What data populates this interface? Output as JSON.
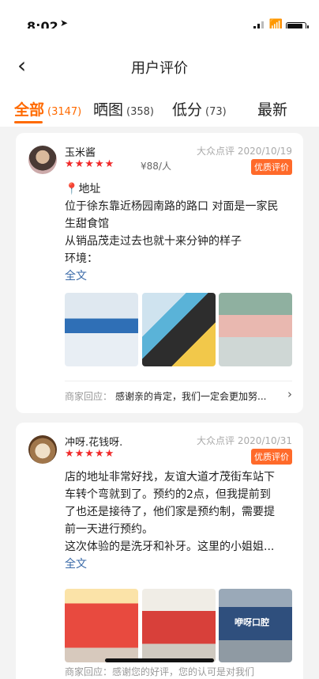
{
  "status": {
    "time": "8:02"
  },
  "header": {
    "title": "用户评价"
  },
  "tabs": [
    {
      "label": "全部",
      "count": "(3147)"
    },
    {
      "label": "晒图",
      "count": "(358)"
    },
    {
      "label": "低分",
      "count": "(73)"
    },
    {
      "label": "最新",
      "count": ""
    }
  ],
  "reviews": [
    {
      "user": "玉米酱",
      "stars": "★★★★★",
      "price": "¥88/人",
      "source": "大众点评",
      "date": "2020/10/19",
      "badge": "优质评价",
      "lines": [
        "地址",
        "位于徐东靠近杨园南路的路口 对面是一家民",
        "生甜食馆",
        "从销品茂走过去也就十来分钟的样子",
        "环境："
      ],
      "more": "全文",
      "reply_label": "商家回应：",
      "reply_text": "感谢亲的肯定，我们一定会更加努..."
    },
    {
      "user": "冲呀.花钱呀.",
      "stars": "★★★★★",
      "source": "大众点评",
      "date": "2020/10/31",
      "badge": "优质评价",
      "lines": [
        "店的地址非常好找，友谊大道才茂街车站下",
        "车转个弯就到了。预约的2点，但我提前到",
        "了也还是接待了，他们家是预约制，需要提",
        "前一天进行预约。",
        "这次体验的是洗牙和补牙。这里的小姐姐..."
      ],
      "more": "全文",
      "photo_logo": "咿呀口腔"
    }
  ],
  "peek_text": "商家回应：感谢您的好评，您的认可是对我们"
}
